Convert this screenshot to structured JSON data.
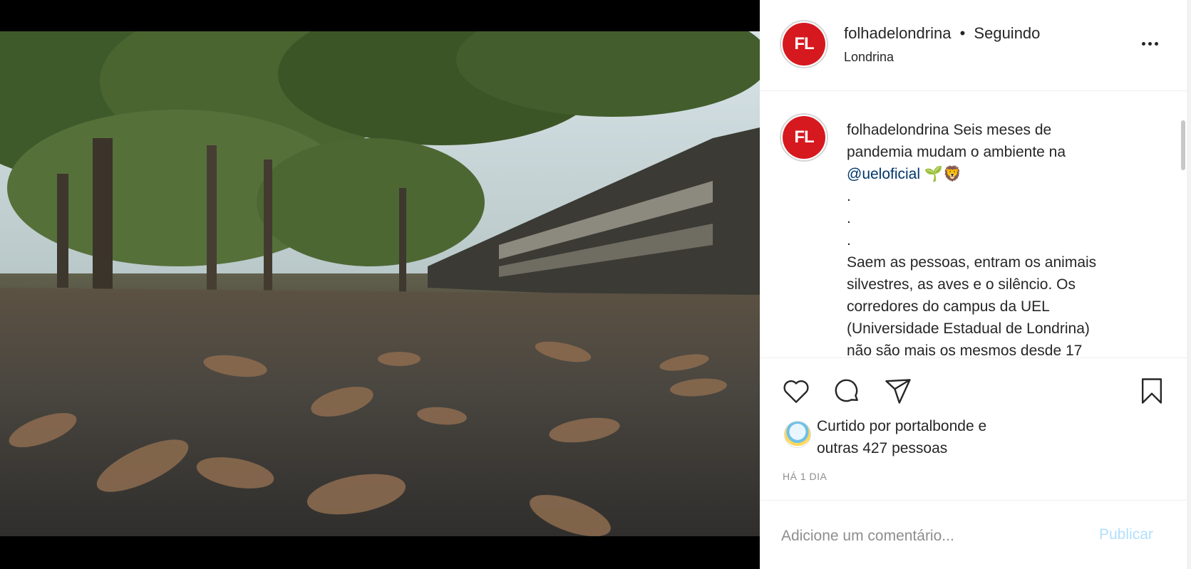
{
  "header": {
    "avatar_text": "FL",
    "username": "folhadelondrina",
    "separator": "•",
    "follow_status": "Seguindo",
    "location": "Londrina"
  },
  "caption": {
    "avatar_text": "FL",
    "username": "folhadelondrina",
    "text_start": "Seis meses de pandemia mudam o ambiente na",
    "mention": "@ueloficial",
    "emoji": "🌱🦁",
    "dot1": ".",
    "dot2": ".",
    "dot3": ".",
    "body": "Saem as pessoas, entram os animais silvestres, as aves e o silêncio. Os corredores do campus da UEL (Universidade Estadual de Londrina) não são mais os mesmos desde 17"
  },
  "likes": {
    "text_line1": "Curtido por portalbonde e",
    "text_line2": "outras 427 pessoas"
  },
  "timestamp": "HÁ 1 DIA",
  "comment": {
    "placeholder": "Adicione um comentário...",
    "publish_label": "Publicar"
  },
  "colors": {
    "brand_red": "#d6191f",
    "publish_disabled": "#b2dffc",
    "mention": "#00376b"
  }
}
